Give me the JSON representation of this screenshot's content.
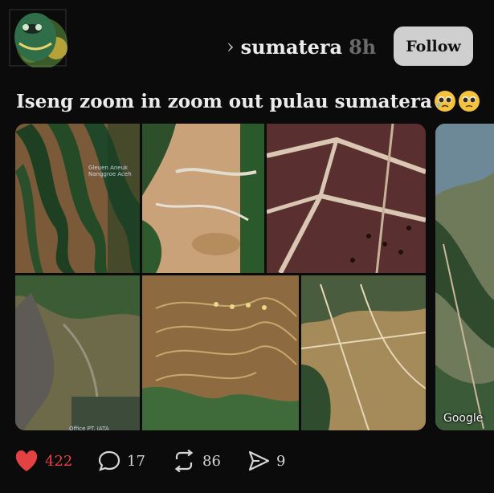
{
  "header": {
    "chevron": "›",
    "username": "sumatera",
    "time": "8h",
    "follow_label": "Follow"
  },
  "post": {
    "caption": "Iseng zoom in zoom out pulau sumatera",
    "emojis": [
      "pleading-face-tear-emoji",
      "pleading-face-emoji"
    ],
    "map_labels": [
      "Gleuen Aneuk",
      "Nanggroe Aceh"
    ],
    "bottom_label": "Office PT. IATA",
    "watermark": "Google"
  },
  "actions": {
    "likes": "422",
    "comments": "17",
    "reposts": "86",
    "shares": "9"
  },
  "colors": {
    "background": "#0b0b0c",
    "like": "#e34242",
    "follow_bg": "#cfcfcf"
  }
}
